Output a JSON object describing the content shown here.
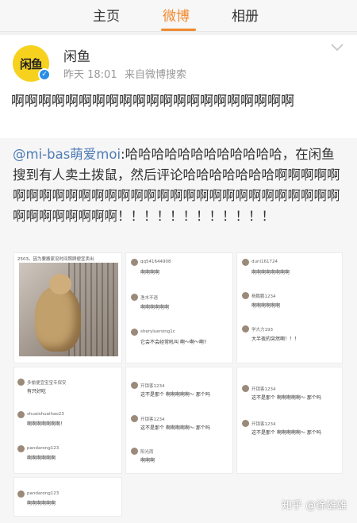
{
  "tabs": {
    "home": "主页",
    "weibo": "微博",
    "album": "相册"
  },
  "post": {
    "avatar_text": "闲鱼",
    "username": "闲鱼",
    "time": "昨天 18:01",
    "source": "来自微博搜索",
    "text": "啊啊啊啊啊啊啊啊啊啊啊啊啊啊啊啊啊啊啊啊啊"
  },
  "repost": {
    "mention": "@mi-bas萌爱moi",
    "text": ":哈哈哈哈哈哈哈哈哈哈哈哈，在闲鱼搜到有人卖土拨鼠，然后评论哈哈哈哈哈哈哈啊啊啊啊啊啊啊啊啊啊啊啊啊啊啊啊啊啊啊啊啊啊啊啊啊啊啊啊啊啊啊啊啊啊啊啊啊啊！！！！！！！！！！！！"
  },
  "screens": {
    "s1_caption": "2503。因为要搬家没时间照顾便宜卖出",
    "s2": [
      {
        "name": "qq541644908",
        "text": "啊啊啊啊",
        "time": ""
      },
      {
        "name": "渔木不语",
        "text": "啊啊啊啊啊啊",
        "time": ""
      },
      {
        "name": "sheryluersing1c",
        "text": "它会不会经常吼叫 啊～啊～啊?",
        "time": ""
      }
    ],
    "s3": [
      {
        "name": "duni161724",
        "text": "啊啊啊啊啊啊啊啊",
        "time": ""
      },
      {
        "name": "杨鹏鹏1234",
        "text": "啊啊啊啊啊啊",
        "time": ""
      },
      {
        "name": "学大力193",
        "text": "大半夜的突然啊！！！",
        "time": ""
      }
    ],
    "s4": [
      {
        "name": "多愉便宜宝宝专保安",
        "text": "有只好吃",
        "time": ""
      },
      {
        "name": "shuaishuaihao23",
        "text": "啊啊啊啊啊啊啊！",
        "time": ""
      },
      {
        "name": "pandarong123",
        "text": "啊啊啊啊啊啊",
        "time": ""
      }
    ],
    "s5": [
      {
        "name": "开锁客1234",
        "text": "这不是那个 啊啊啊啊啊～ 那个吗",
        "time": ""
      },
      {
        "name": "开锁客1234",
        "text": "这不是那个 啊啊啊啊啊～ 那个吗",
        "time": ""
      },
      {
        "name": "阳光雨",
        "text": "啊啊啊",
        "time": ""
      }
    ],
    "s6": [
      {
        "name": "开锁客1234",
        "text": "这不是那个 啊啊啊啊啊～ 那个吗",
        "time": ""
      },
      {
        "name": "开锁客1234",
        "text": "这不是那个 啊啊啊啊啊～ 那个吗",
        "time": ""
      }
    ],
    "s7": [
      {
        "name": "pandarong123",
        "text": "啊啊啊啊啊啊",
        "time": ""
      }
    ]
  },
  "watermark": "知乎 @徐雄雄"
}
